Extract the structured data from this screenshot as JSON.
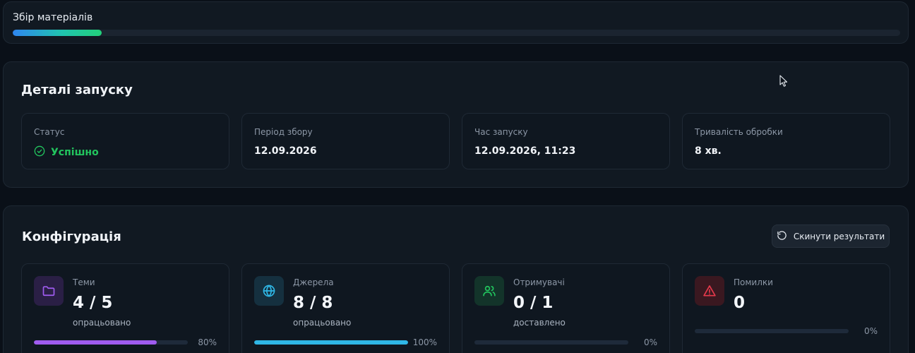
{
  "progress": {
    "label": "Збір матеріалів",
    "fraction": 0.1
  },
  "details": {
    "title": "Деталі запуску",
    "cards": [
      {
        "label": "Статус",
        "value": "Успішно"
      },
      {
        "label": "Період збору",
        "value": "12.09.2026"
      },
      {
        "label": "Час запуску",
        "value": "12.09.2026, 11:23"
      },
      {
        "label": "Тривалість обробки",
        "value": "8 хв."
      }
    ]
  },
  "config": {
    "title": "Конфігурація",
    "reset_label": "Скинути результати",
    "stats": [
      {
        "icon": "folder-icon",
        "label": "Теми",
        "value": "4 / 5",
        "sub": "опрацьовано",
        "percent": 80,
        "percent_label": "80%",
        "color": "#a05cf0",
        "icon_bg": "#2a1f45"
      },
      {
        "icon": "globe-icon",
        "label": "Джерела",
        "value": "8 / 8",
        "sub": "опрацьовано",
        "percent": 100,
        "percent_label": "100%",
        "color": "#2fb7e6",
        "icon_bg": "#15303f"
      },
      {
        "icon": "users-icon",
        "label": "Отримувачі",
        "value": "0 / 1",
        "sub": "доставлено",
        "percent": 0,
        "percent_label": "0%",
        "color": "#22c55e",
        "icon_bg": "#13342a"
      },
      {
        "icon": "warning-icon",
        "label": "Помилки",
        "value": "0",
        "sub": "",
        "percent": 0,
        "percent_label": "0%",
        "color": "#e5394b",
        "icon_bg": "#3a1820"
      }
    ]
  }
}
